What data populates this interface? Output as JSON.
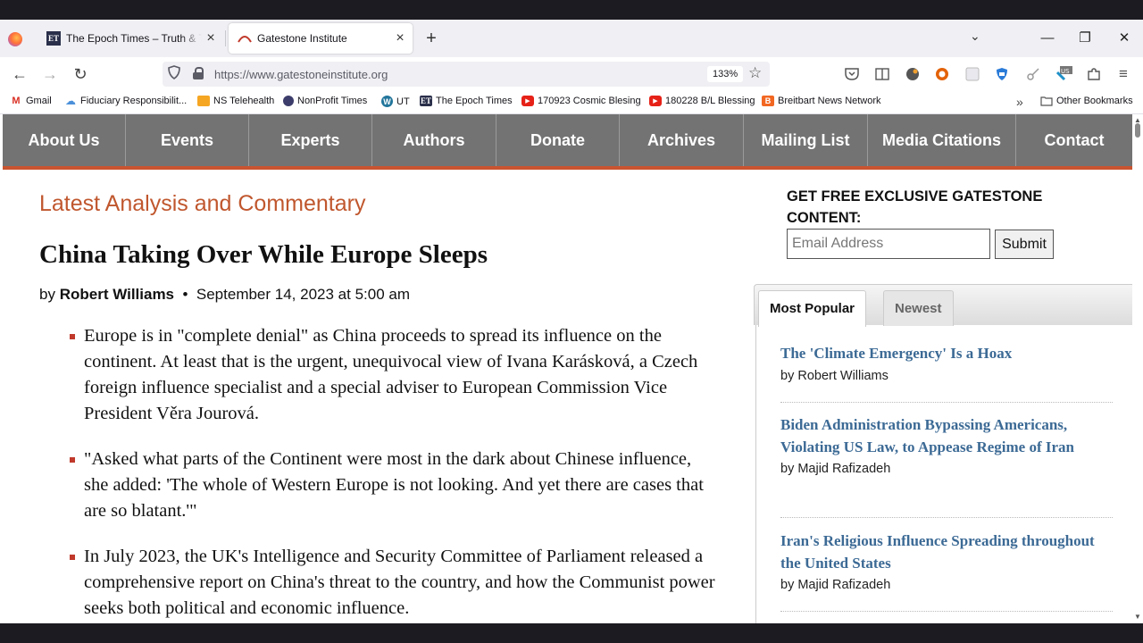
{
  "browser": {
    "tabs": [
      {
        "title": "The Epoch Times – Truth & Trad",
        "favicon": "ET"
      },
      {
        "title": "Gatestone Institute",
        "favicon": "gatestone-logo"
      }
    ],
    "new_tab": "+",
    "url": "https://www.gatestoneinstitute.org",
    "zoom": "133%",
    "bookmarks": [
      {
        "label": "Gmail",
        "icon": "M"
      },
      {
        "label": "Fiduciary Responsibilit...",
        "icon": "cloud"
      },
      {
        "label": "NS Telehealth",
        "icon": "flag"
      },
      {
        "label": "NonProfit Times",
        "icon": "globe"
      },
      {
        "label": "UT",
        "icon": "W"
      },
      {
        "label": "The Epoch Times",
        "icon": "ET"
      },
      {
        "label": "170923 Cosmic Blesing",
        "icon": "play"
      },
      {
        "label": "180228 B/L Blessing",
        "icon": "play"
      },
      {
        "label": "Breitbart News Network",
        "icon": "B"
      }
    ],
    "other_bookmarks": "Other Bookmarks"
  },
  "site": {
    "nav": [
      "About Us",
      "Events",
      "Experts",
      "Authors",
      "Donate",
      "Archives",
      "Mailing List",
      "Media Citations",
      "Contact"
    ],
    "section_title": "Latest Analysis and Commentary",
    "article": {
      "headline": "China Taking Over While Europe Sleeps",
      "by": "by",
      "author": "Robert Williams",
      "separator": "•",
      "date": "September 14, 2023 at 5:00 am",
      "bullets": [
        "Europe is in \"complete denial\" as China proceeds to spread its influence on the continent. At least that is the urgent, unequivocal view of Ivana Karásková, a Czech foreign influence specialist and a special adviser to European Commission Vice President Věra Jourová.",
        "\"Asked what parts of the Continent were most in the dark about Chinese influence, she added: 'The whole of Western Europe is not looking. And yet there are cases that are so blatant.'\"",
        "In July 2023, the UK's Intelligence and Security Committee of Parliament released a comprehensive report on China's threat to the country, and how the Communist power seeks both political and economic influence."
      ]
    },
    "sidebar": {
      "promo": "GET FREE EXCLUSIVE GATESTONE CONTENT:",
      "email_placeholder": "Email Address",
      "submit": "Submit",
      "tabs": [
        "Most Popular",
        "Newest"
      ],
      "popular": [
        {
          "title": "The 'Climate Emergency' Is a Hoax",
          "author": "by Robert Williams"
        },
        {
          "title": "Biden Administration Bypassing Americans, Violating US Law, to Appease Regime of Iran",
          "author": "by Majid Rafizadeh"
        },
        {
          "title": "Iran's Religious Influence Spreading throughout the United States",
          "author": "by Majid Rafizadeh"
        }
      ]
    }
  },
  "colors": {
    "nav_bg": "#737373",
    "nav_accent": "#c95430",
    "section_title": "#c0572e",
    "link": "#3c6a95",
    "bullet": "#c0392b"
  }
}
